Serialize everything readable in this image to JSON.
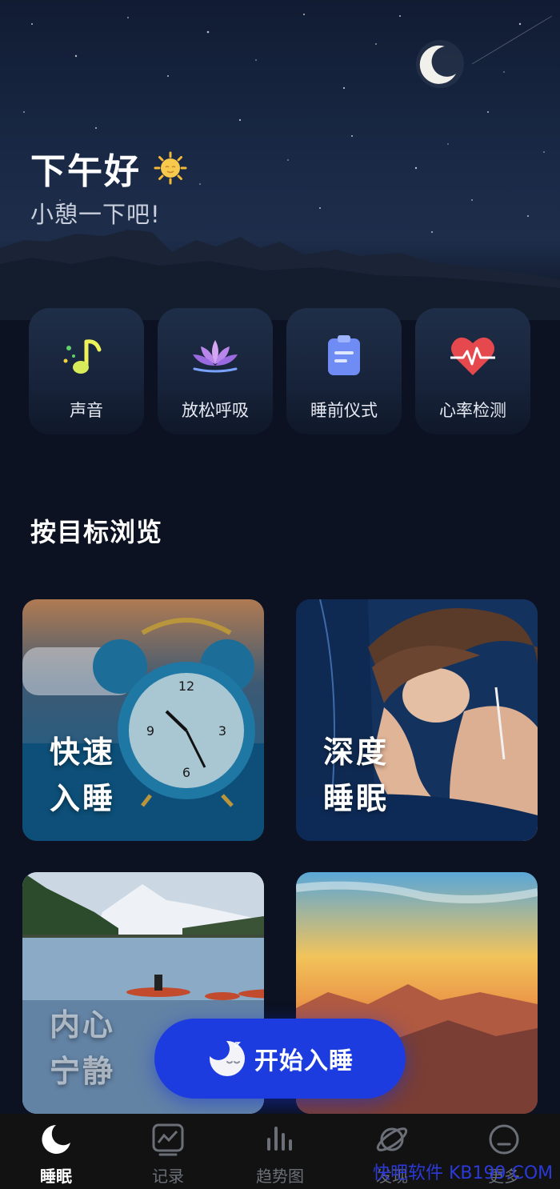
{
  "header": {
    "greeting": "下午好",
    "subtitle": "小憩一下吧!"
  },
  "actions": [
    {
      "label": "声音",
      "icon": "music-note-icon"
    },
    {
      "label": "放松呼吸",
      "icon": "lotus-icon"
    },
    {
      "label": "睡前仪式",
      "icon": "clipboard-icon"
    },
    {
      "label": "心率检测",
      "icon": "heart-rate-icon"
    }
  ],
  "section": {
    "title": "按目标浏览"
  },
  "goals": [
    {
      "line1": "快速",
      "line2": "入睡"
    },
    {
      "line1": "深度",
      "line2": "睡眠"
    },
    {
      "line1": "内心",
      "line2": "宁静"
    }
  ],
  "start_button": {
    "label": "开始入睡"
  },
  "nav": [
    {
      "label": "睡眠",
      "icon": "moon-icon",
      "active": true
    },
    {
      "label": "记录",
      "icon": "chart-record-icon"
    },
    {
      "label": "趋势图",
      "icon": "bar-chart-icon"
    },
    {
      "label": "发现",
      "icon": "planet-icon"
    },
    {
      "label": "更多",
      "icon": "smiley-icon"
    }
  ],
  "watermark": {
    "text": "快吧软件 KB199.COM"
  },
  "colors": {
    "background": "#0c1221",
    "accent": "#1d3ce0",
    "nav_bg": "#121212"
  }
}
